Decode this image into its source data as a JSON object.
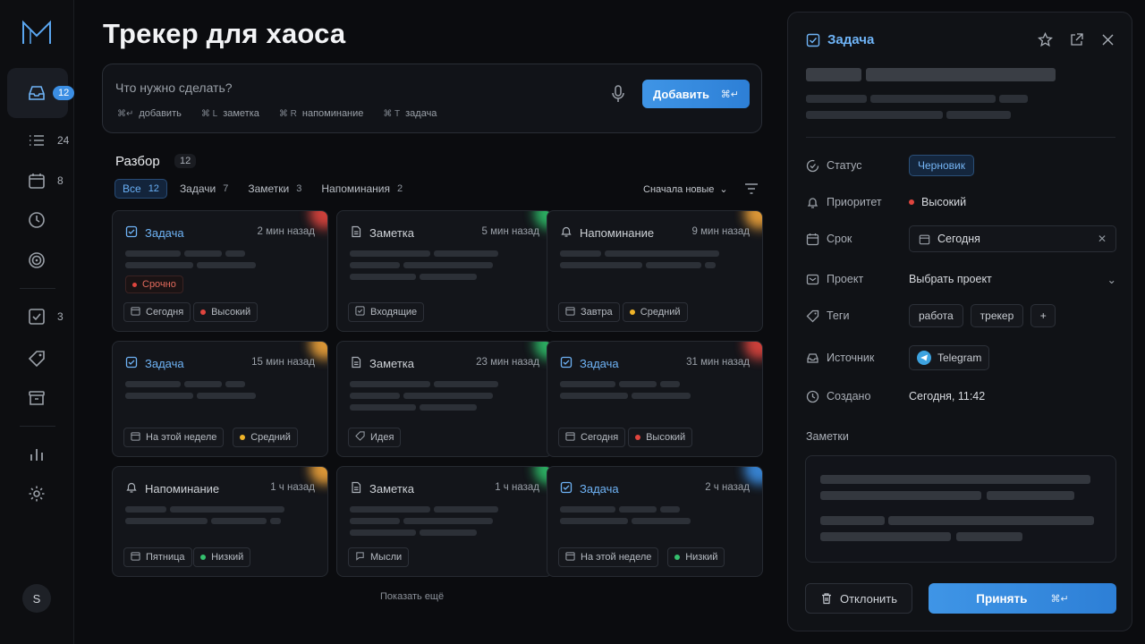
{
  "app": {
    "title": "Трекер для хаоса"
  },
  "rail": {
    "items": [
      {
        "icon": "inbox-icon",
        "badge": "12"
      },
      {
        "icon": "list-icon",
        "count": "24"
      },
      {
        "icon": "calendar-icon",
        "count": "8"
      },
      {
        "icon": "clock-icon"
      },
      {
        "icon": "target-icon"
      },
      {
        "icon": "checkbox-icon",
        "count": "3"
      },
      {
        "icon": "tag-icon"
      },
      {
        "icon": "archive-icon"
      },
      {
        "icon": "chart-icon"
      },
      {
        "icon": "gear-icon"
      }
    ],
    "avatar": "S"
  },
  "capture": {
    "placeholder": "Что нужно сделать?",
    "hints": [
      {
        "key": "⌘↵",
        "label": "добавить"
      },
      {
        "key": "⌘ L",
        "label": "заметка"
      },
      {
        "key": "⌘ R",
        "label": "напоминание"
      },
      {
        "key": "⌘ T",
        "label": "задача"
      }
    ],
    "add_label": "Добавить",
    "add_shortcut": "⌘↵"
  },
  "section": {
    "title": "Разбор",
    "count": "12",
    "filters": [
      {
        "label": "Все",
        "count": "12"
      },
      {
        "label": "Задачи",
        "count": "7"
      },
      {
        "label": "Заметки",
        "count": "3"
      },
      {
        "label": "Напоминания",
        "count": "2"
      }
    ],
    "sort": "Сначала новые",
    "show_more": "Показать ещё"
  },
  "cards": [
    {
      "kind": "task",
      "title": "Задача",
      "time": "2 мин назад",
      "glow": "#e0453e",
      "urgent": "Срочно",
      "tags": [
        {
          "icon": "calendar",
          "label": "Сегодня"
        },
        {
          "dot": "#e0453e",
          "label": "Высокий"
        }
      ]
    },
    {
      "kind": "note",
      "title": "Заметка",
      "time": "5 мин назад",
      "glow": "#2fbf6a",
      "tags": [
        {
          "icon": "inbox",
          "label": "Входящие"
        }
      ]
    },
    {
      "kind": "reminder",
      "title": "Напоминание",
      "time": "9 мин назад",
      "glow": "#f0a43a",
      "tags": [
        {
          "icon": "calendar",
          "label": "Завтра"
        },
        {
          "dot": "#f0b429",
          "label": "Средний"
        }
      ]
    },
    {
      "kind": "task",
      "title": "Задача",
      "time": "15 мин назад",
      "glow": "#f0a43a",
      "tags": [
        {
          "icon": "calendar",
          "label": "На этой неделе"
        },
        {
          "dot": "#f0b429",
          "label": "Средний"
        }
      ]
    },
    {
      "kind": "note",
      "title": "Заметка",
      "time": "23 мин назад",
      "glow": "#2fbf6a",
      "tags": [
        {
          "icon": "tag",
          "label": "Идея"
        }
      ]
    },
    {
      "kind": "task",
      "title": "Задача",
      "time": "31 мин назад",
      "glow": "#e0453e",
      "tags": [
        {
          "icon": "calendar",
          "label": "Сегодня"
        },
        {
          "dot": "#e0453e",
          "label": "Высокий"
        }
      ]
    },
    {
      "kind": "reminder",
      "title": "Напоминание",
      "time": "1 ч назад",
      "glow": "#f0a43a",
      "tags": [
        {
          "icon": "calendar",
          "label": "Пятница"
        },
        {
          "dot": "#35c06e",
          "label": "Низкий"
        }
      ]
    },
    {
      "kind": "note",
      "title": "Заметка",
      "time": "1 ч назад",
      "glow": "#2fbf6a",
      "tags": [
        {
          "icon": "bubble",
          "label": "Мысли"
        }
      ]
    },
    {
      "kind": "task",
      "title": "Задача",
      "time": "2 ч назад",
      "glow": "#3b8ee3",
      "tags": [
        {
          "icon": "calendar",
          "label": "На этой неделе"
        },
        {
          "dot": "#35c06e",
          "label": "Низкий"
        }
      ]
    }
  ],
  "detail": {
    "type_label": "Задача",
    "fields": {
      "status_label": "Статус",
      "status_value": "Черновик",
      "priority_label": "Приоритет",
      "priority_value": "Высокий",
      "due_label": "Срок",
      "due_value": "Сегодня",
      "project_label": "Проект",
      "project_value": "Выбрать проект",
      "tags_label": "Теги",
      "tags": [
        "работа",
        "трекер"
      ],
      "source_label": "Источник",
      "source_value": "Telegram",
      "created_label": "Создано",
      "created_value": "Сегодня, 11:42"
    },
    "notes_label": "Заметки",
    "reject_label": "Отклонить",
    "accept_label": "Принять",
    "accept_shortcut": "⌘↵"
  },
  "colors": {
    "accent": "#3b8ee3",
    "high": "#e0453e",
    "medium": "#f0b429",
    "low": "#35c06e"
  }
}
